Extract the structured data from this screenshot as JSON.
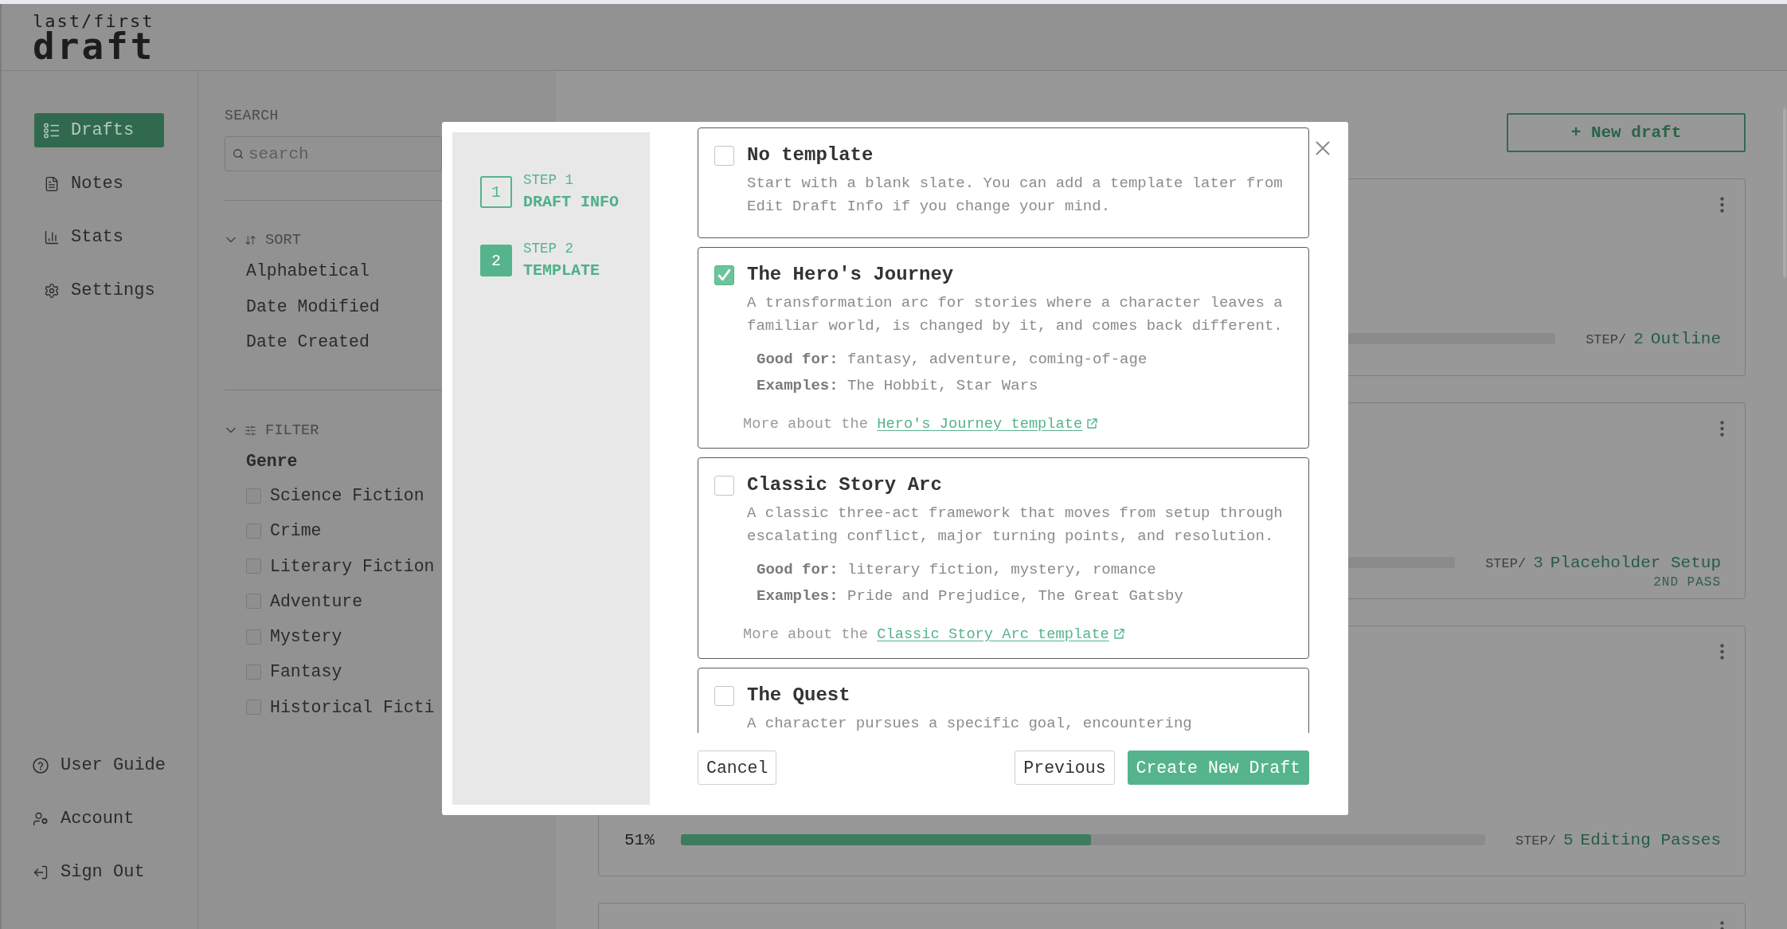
{
  "header": {
    "logo_top": "last/first",
    "logo_main": "draft"
  },
  "nav": {
    "items": [
      {
        "label": "Drafts",
        "selected": true
      },
      {
        "label": "Notes",
        "selected": false
      },
      {
        "label": "Stats",
        "selected": false
      },
      {
        "label": "Settings",
        "selected": false
      }
    ],
    "footer_items": [
      {
        "label": "User Guide"
      },
      {
        "label": "Account"
      },
      {
        "label": "Sign Out"
      }
    ]
  },
  "filters": {
    "search": {
      "label": "SEARCH",
      "placeholder": "search"
    },
    "sort": {
      "title": "SORT",
      "expanded": true,
      "options": [
        "Alphabetical",
        "Date Modified",
        "Date Created"
      ]
    },
    "filter": {
      "title": "FILTER",
      "expanded": true,
      "group": "Genre",
      "options": [
        {
          "label": "Science Fiction",
          "checked": false
        },
        {
          "label": "Crime",
          "checked": false
        },
        {
          "label": "Literary Fiction",
          "checked": false
        },
        {
          "label": "Adventure",
          "checked": false
        },
        {
          "label": "Mystery",
          "checked": false
        },
        {
          "label": "Fantasy",
          "checked": false
        },
        {
          "label": "Historical Ficti",
          "checked": false
        }
      ]
    }
  },
  "drafts": {
    "new_button": "+ New draft",
    "cards": [
      {
        "menu": true,
        "step_prefix": "STEP/",
        "step_number": "2",
        "step_name": "Outline"
      },
      {
        "menu": true,
        "step_prefix": "STEP/",
        "step_number": "3",
        "step_name": "Placeholder Setup",
        "pass": "2ND PASS"
      },
      {
        "menu": true,
        "percent": "51%",
        "level": 0.51,
        "step_prefix": "STEP/",
        "step_number": "5",
        "step_name": "Editing Passes"
      },
      {
        "menu": true
      }
    ]
  },
  "modal": {
    "steps": [
      {
        "number": "1",
        "label": "STEP 1",
        "title": "DRAFT INFO",
        "selected": false
      },
      {
        "number": "2",
        "label": "STEP 2",
        "title": "TEMPLATE",
        "selected": true
      }
    ],
    "templates": [
      {
        "title": "No template",
        "selected": false,
        "description": "Start with a blank slate. You can add a template later from Edit Draft Info if you change your mind."
      },
      {
        "title": "The Hero's Journey",
        "selected": true,
        "description": "A transformation arc for stories where a character leaves a familiar world, is changed by it, and comes back different.",
        "meta": [
          "**Good for:** fantasy, adventure, coming-of-age",
          "**Examples:** The Hobbit, Star Wars"
        ],
        "more": {
          "prefix": "More about the",
          "link": "Hero's Journey template"
        }
      },
      {
        "title": "Classic Story Arc",
        "selected": false,
        "description": "A classic three-act framework that moves from setup through escalating conflict, major turning points, and resolution.",
        "meta": [
          "**Good for:** literary fiction, mystery, romance",
          "**Examples:** Pride and Prejudice, The Great Gatsby"
        ],
        "more": {
          "prefix": "More about the",
          "link": "Classic Story Arc template"
        }
      },
      {
        "title": "The Quest",
        "selected": false,
        "description": "A character pursues a specific goal, encountering"
      }
    ],
    "footer": {
      "left": [
        {
          "label": "Cancel",
          "kind": "outline"
        }
      ],
      "right": [
        {
          "label": "Previous",
          "kind": "outline"
        },
        {
          "label": "Create New Draft",
          "kind": "primary"
        }
      ]
    }
  }
}
